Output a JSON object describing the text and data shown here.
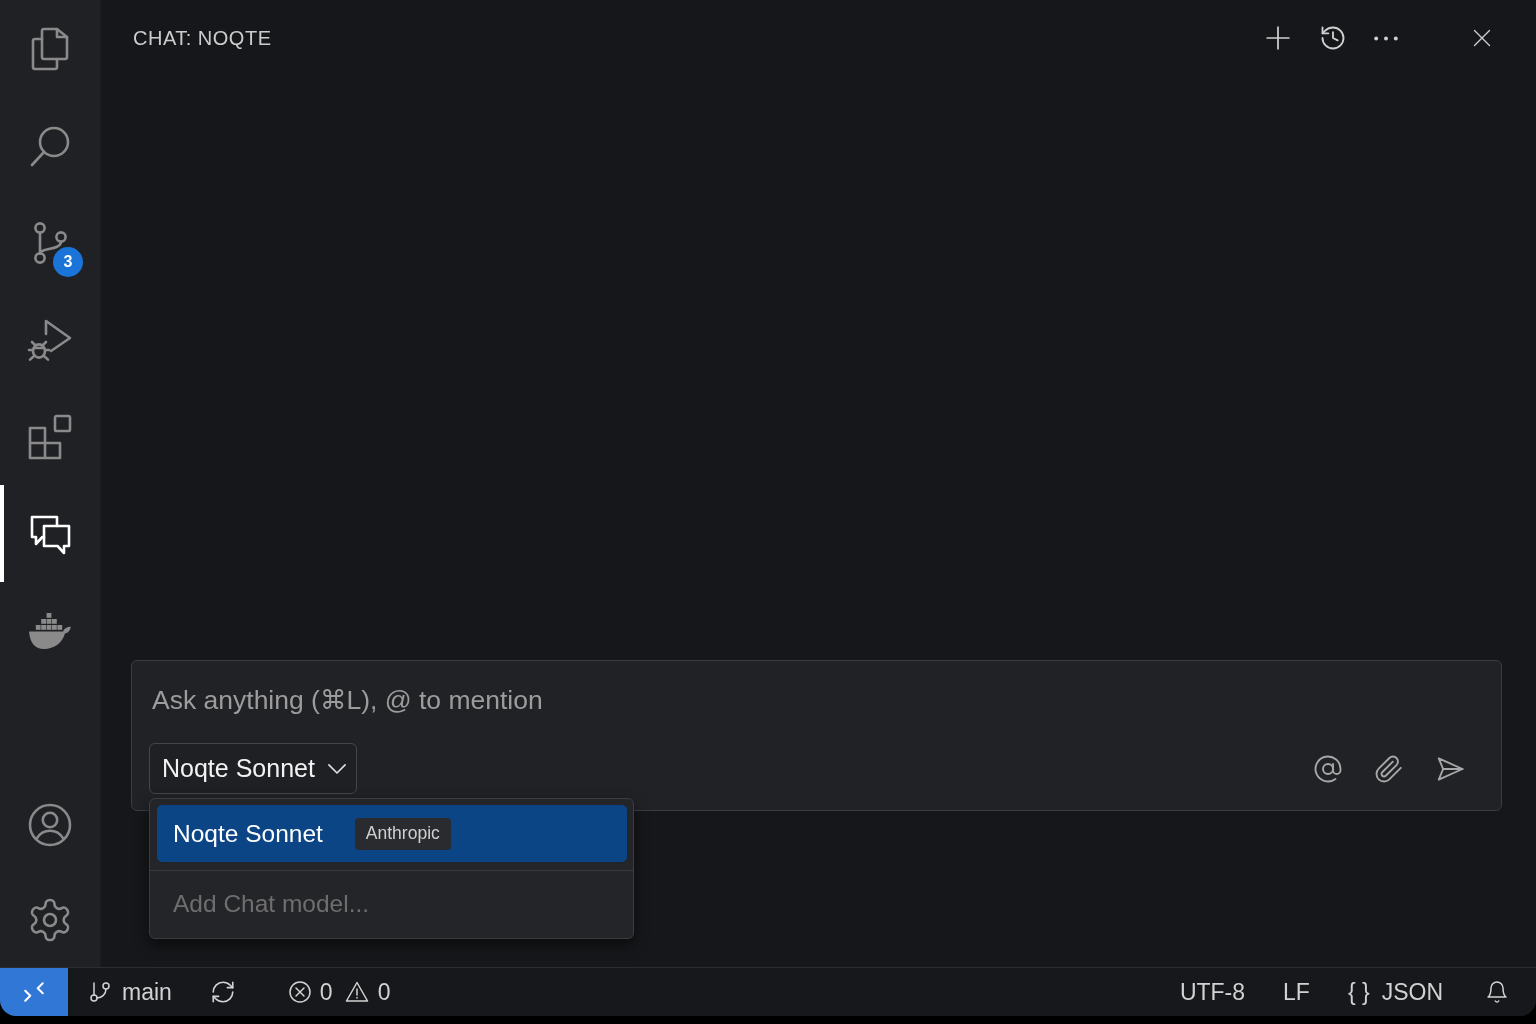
{
  "activity_bar": {
    "items": [
      {
        "kind": "explorer",
        "selected": false
      },
      {
        "kind": "search",
        "selected": false
      },
      {
        "kind": "source_control",
        "selected": false,
        "badge": "3"
      },
      {
        "kind": "run_debug",
        "selected": false
      },
      {
        "kind": "extensions",
        "selected": false
      },
      {
        "kind": "chat",
        "selected": true
      },
      {
        "kind": "docker",
        "selected": false
      }
    ],
    "bottom_items": [
      {
        "kind": "accounts"
      },
      {
        "kind": "manage"
      }
    ]
  },
  "chat_panel": {
    "title": "CHAT: NOQTE",
    "input": {
      "placeholder": "Ask anything (⌘L), @ to mention",
      "model_picker": {
        "label": "Noqte Sonnet",
        "expanded": true
      },
      "model_menu": [
        {
          "kind": "model",
          "label": "Noqte Sonnet",
          "provider": "Anthropic",
          "selected": true
        },
        {
          "kind": "action",
          "label": "Add Chat model...",
          "selected": false
        }
      ]
    }
  },
  "status_bar": {
    "branch": "main",
    "errors": "0",
    "warnings": "0",
    "encoding": "UTF-8",
    "line_ending": "LF",
    "language_icon": "{ }",
    "language": "JSON"
  }
}
